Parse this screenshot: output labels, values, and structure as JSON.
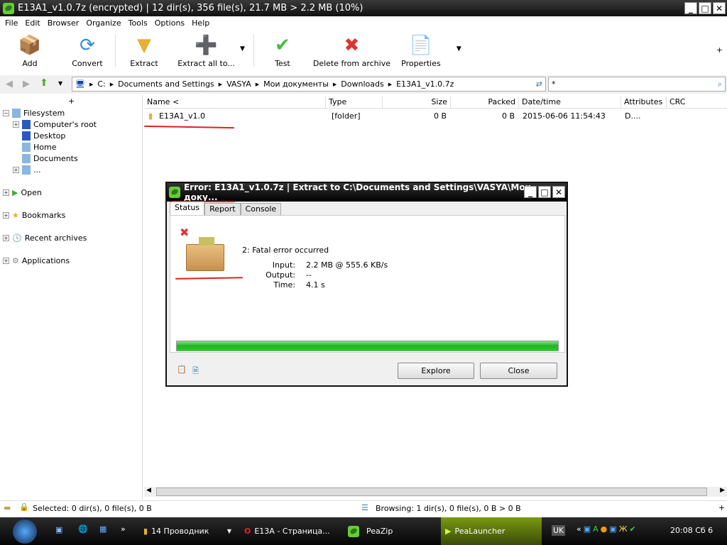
{
  "window": {
    "title": "E13A1_v1.0.7z (encrypted) | 12 dir(s), 356 file(s), 21.7 MB > 2.2 MB (10%)"
  },
  "menu": [
    "File",
    "Edit",
    "Browser",
    "Organize",
    "Tools",
    "Options",
    "Help"
  ],
  "toolbar": {
    "add": "Add",
    "convert": "Convert",
    "extract": "Extract",
    "extract_all": "Extract all to...",
    "test": "Test",
    "delete": "Delete from archive",
    "properties": "Properties"
  },
  "address": {
    "path": [
      "C:",
      "Documents and Settings",
      "VASYA",
      "Мои документы",
      "Downloads",
      "E13A1_v1.0.7z"
    ],
    "search": "*"
  },
  "tree": {
    "plus": "+",
    "items": [
      "Filesystem",
      "Computer's root",
      "Desktop",
      "Home",
      "Documents",
      "...",
      "Open",
      "Bookmarks",
      "Recent archives",
      "Applications"
    ]
  },
  "columns": [
    "Name <",
    "Type",
    "Size",
    "Packed",
    "Date/time",
    "Attributes",
    "CRC"
  ],
  "rows": [
    {
      "name": "E13A1_v1.0",
      "type": "[folder]",
      "size": "0 B",
      "packed": "0 B",
      "date": "2015-06-06 11:54:43",
      "attr": "D...."
    }
  ],
  "statusbar": {
    "selected": "Selected: 0 dir(s), 0 file(s), 0 B",
    "browsing": "Browsing: 1 dir(s), 0 file(s), 0 B > 0 B",
    "plus": "+"
  },
  "dialog": {
    "title": "Error: E13A1_v1.0.7z | Extract to C:\\Documents and Settings\\VASYA\\Мои доку...",
    "tabs": [
      "Status",
      "Report",
      "Console"
    ],
    "message": "2: Fatal error occurred",
    "input_label": "Input:",
    "input": "2.2 MB @ 555.6 KB/s",
    "output_label": "Output:",
    "output": "--",
    "time_label": "Time:",
    "time": "4.1 s",
    "progress": 100,
    "explore": "Explore",
    "close": "Close"
  },
  "taskbar": {
    "items": [
      "14 Проводник",
      "E13A - Страница...",
      "PeaZip",
      "PeaLauncher"
    ],
    "lang": "UK",
    "clock": "20:08 Сб 6"
  }
}
